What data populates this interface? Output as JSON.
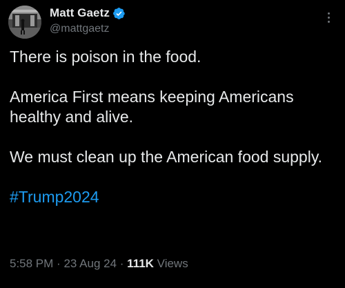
{
  "author": {
    "display_name": "Matt Gaetz",
    "handle": "@mattgaetz",
    "verified_icon": "verified-badge-icon",
    "avatar_icon": "avatar"
  },
  "tweet": {
    "paragraphs": [
      "There is poison in the food.",
      "America First means keeping Americans healthy and alive.",
      "We must clean up the American food supply."
    ],
    "hashtag": "#Trump2024"
  },
  "meta": {
    "time": "5:58 PM",
    "separator": "·",
    "date": "23 Aug 24",
    "views_count": "111K",
    "views_label": "Views"
  },
  "colors": {
    "background": "#000000",
    "text_primary": "#e7e9ea",
    "text_secondary": "#71767b",
    "link": "#1d9bf0",
    "verified": "#1d9bf0"
  }
}
